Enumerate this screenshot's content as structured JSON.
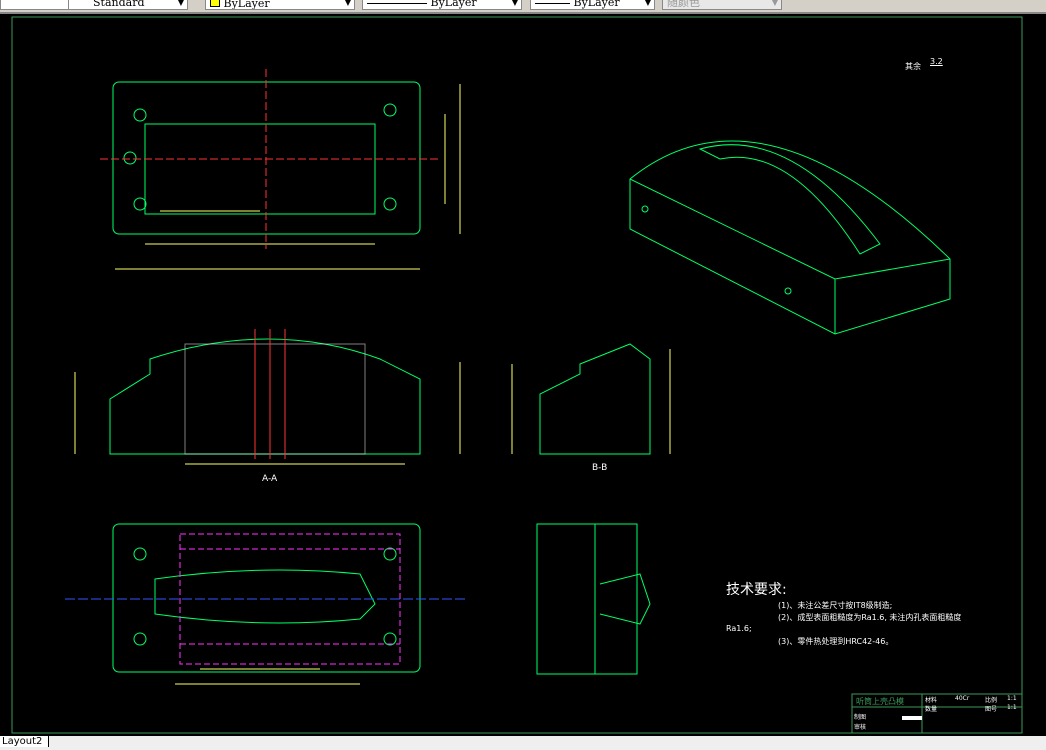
{
  "toolbar": {
    "textstyle": "Standard",
    "layer_color": "ByLayer",
    "linetype": "ByLayer",
    "lineweight": "ByLayer",
    "plotstyle": "随颜色",
    "layer_color_swatch": "#ffff00"
  },
  "drawing": {
    "roughness_note": "其余",
    "roughness_value": "3.2",
    "section_aa": "A-A",
    "section_bb": "B-B",
    "tech_title": "技术要求:",
    "tech_items": [
      "(1)、未注公差尺寸按IT8级制造;",
      "(2)、成型表面粗糙度为Ra1.6, 未注内孔表面粗糙度",
      "Ra1.6;",
      "(3)、零件热处理到HRC42-46。"
    ],
    "title_block": {
      "part_name": "听筒上壳凸模",
      "material_label": "材料",
      "material": "40Cr",
      "scale_label": "比例",
      "scale": "1:1",
      "qty_label": "数量",
      "drawing_no_label": "图号",
      "drawing_no": "1:1",
      "drawn_label": "制图",
      "checked_label": "审核"
    },
    "colors": {
      "border": "#3c9a5a",
      "geometry": "#00ff66",
      "dimension": "#ffff66",
      "center": "#ff3333",
      "hidden": "#ff33ff",
      "hatch": "#ffffff"
    }
  },
  "tabs": {
    "active": "Layout2"
  }
}
